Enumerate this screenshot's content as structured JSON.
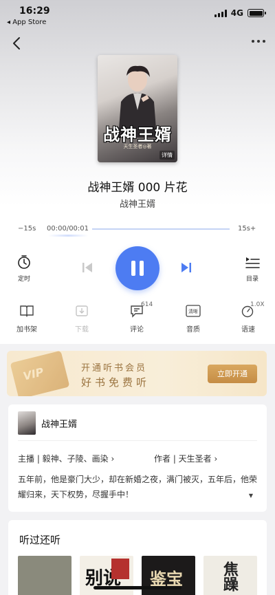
{
  "status_bar": {
    "time": "16:29",
    "back_app": "◂ App Store",
    "network": "4G"
  },
  "cover": {
    "title": "战神王婿",
    "author": "天生圣者◎著",
    "detail_label": "详情"
  },
  "track": {
    "title": "战神王婿 000 片花",
    "subtitle": "战神王婿"
  },
  "player": {
    "skip_back": "−15s",
    "time": "00:00/00:01",
    "skip_forward": "15s+",
    "progress_fraction": 0.0,
    "timer_label": "定时",
    "playlist_label": "目录"
  },
  "actions": {
    "bookshelf": "加书架",
    "download": "下载",
    "comments": "评论",
    "comments_count": "614",
    "quality": "音质",
    "quality_icon_text": "清晰",
    "speed": "语速",
    "speed_value": "1.0X"
  },
  "vip": {
    "card_text": "VIP",
    "line1": "开通听书会员",
    "line2": "好书免费听",
    "button": "立即开通"
  },
  "info": {
    "name": "战神王婿",
    "host": "主播 | 毅神、子陵、画染 ›",
    "author": "作者 | 天生圣者 ›",
    "description": "五年前，他是豪门大少，却在新婚之夜，满门被灭，五年后，他荣耀归来，天下权势，尽握手中！",
    "expand_icon": "▼"
  },
  "recommend": {
    "title": "听过还听",
    "item2_text": "别说",
    "item3_text": "鉴宝",
    "item4_text": "焦躁"
  },
  "colors": {
    "accent": "#4d7cf2",
    "vip_gold": "#9b7440"
  }
}
